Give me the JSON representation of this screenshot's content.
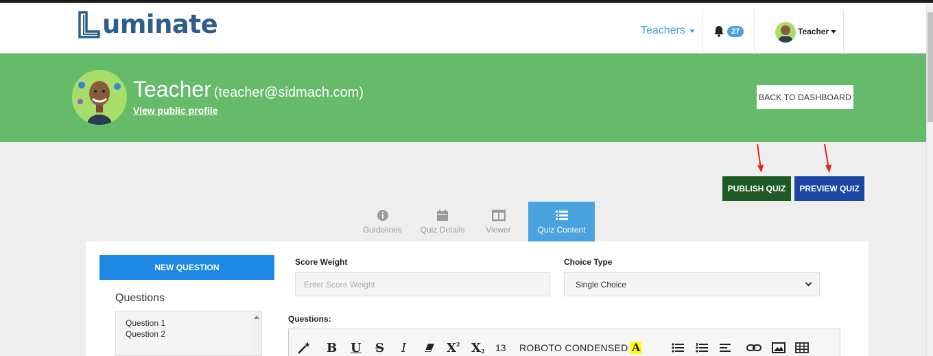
{
  "app": {
    "logo_text": "uminate",
    "logo_initial": "L"
  },
  "navbar": {
    "teachers_label": "Teachers",
    "notification_count": "27",
    "user_label": "Teacher"
  },
  "profile": {
    "name": "Teacher",
    "email": "(teacher@sidmach.com)",
    "public_profile_link": "View public profile",
    "back_button": "BACK TO DASHBOARD"
  },
  "actions": {
    "publish_label": "PUBLISH QUIZ",
    "preview_label": "PREVIEW QUIZ"
  },
  "tabs": [
    {
      "label": "Guidelines",
      "icon": "info-circle-icon"
    },
    {
      "label": "Quiz Details",
      "icon": "calendar-icon"
    },
    {
      "label": "Viewer",
      "icon": "columns-icon"
    },
    {
      "label": "Quiz Content",
      "icon": "list-icon",
      "active": true
    }
  ],
  "sidebar": {
    "new_question_label": "NEW QUESTION",
    "questions_title": "Questions",
    "questions": [
      "Question 1",
      "Question 2"
    ]
  },
  "form": {
    "score_weight_label": "Score Weight",
    "score_weight_placeholder": "Enter Score Weight",
    "choice_type_label": "Choice Type",
    "choice_type_value": "Single Choice",
    "questions_label": "Questions:"
  },
  "editor_toolbar": {
    "font_size": "13",
    "font_name": "ROBOTO CONDENSED",
    "highlight_glyph": "A",
    "bold_glyph": "B",
    "underline_glyph": "U",
    "strike_glyph": "S",
    "italic_glyph": "I",
    "superscript_glyph": "X",
    "subscript_glyph": "X"
  },
  "colors": {
    "hero_green": "#66bb6a",
    "accent_blue": "#4aa3df",
    "publish_green": "#1e5a26",
    "preview_blue": "#1b46a3",
    "new_question_blue": "#1e88e5"
  }
}
